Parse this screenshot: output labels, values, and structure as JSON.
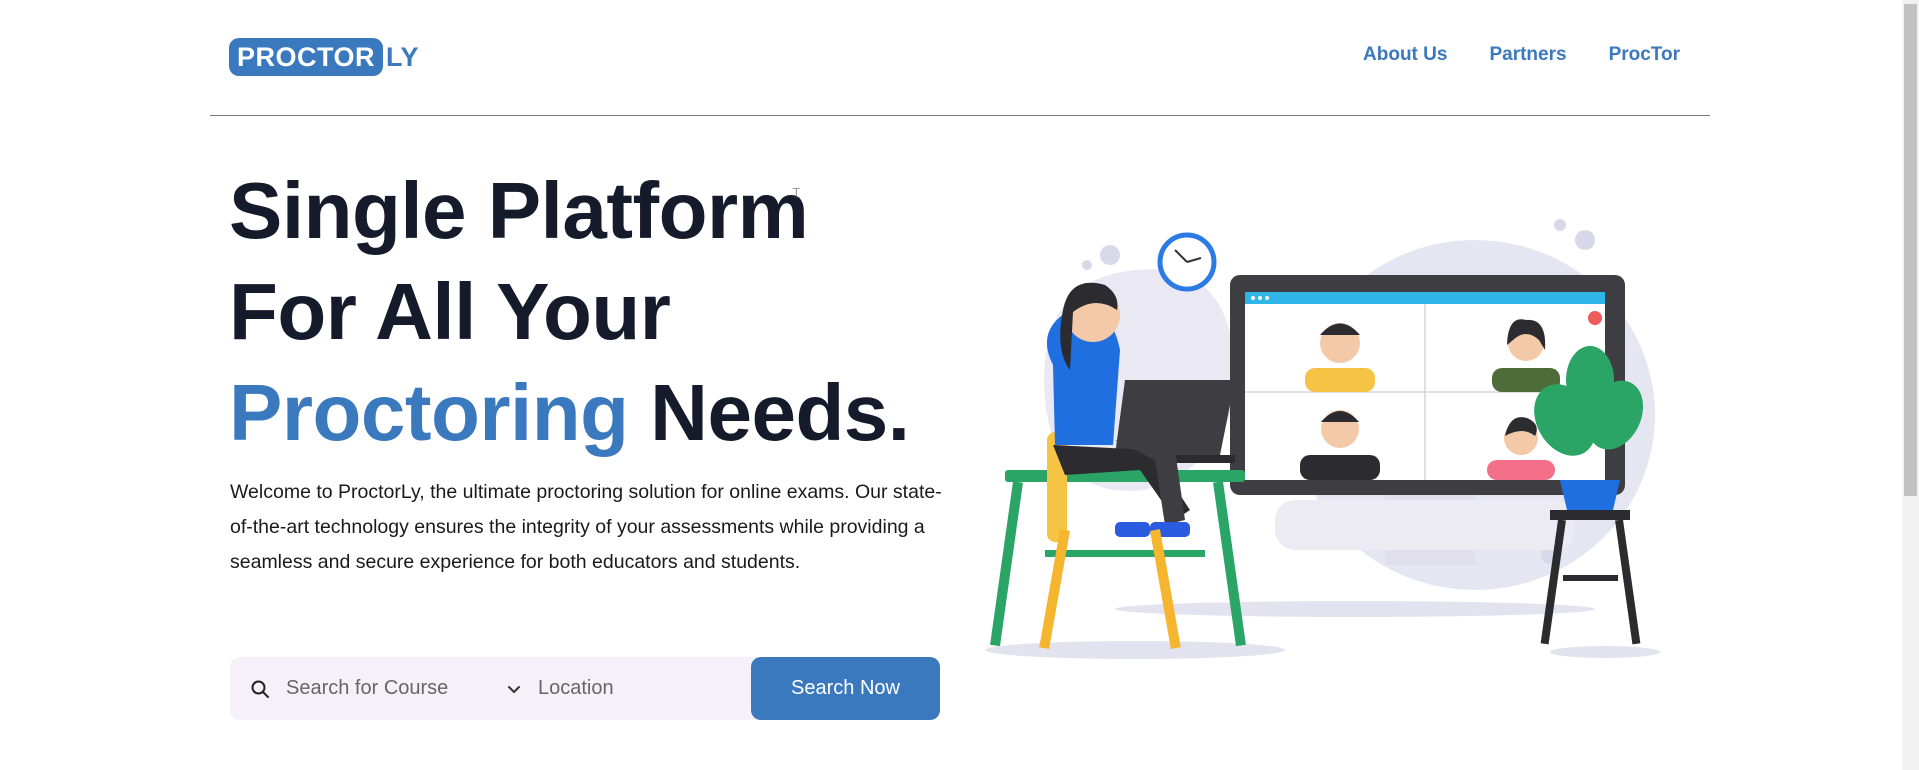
{
  "header": {
    "logo": {
      "boxed": "PROCTOR",
      "rest": "LY"
    },
    "nav": [
      "About Us",
      "Partners",
      "ProcTor"
    ]
  },
  "hero": {
    "title": {
      "line1": "Single Platform",
      "line2": "For All Your",
      "line3_accent": "Proctoring",
      "line3_rest": " Needs."
    },
    "description": "Welcome to ProctorLy, the ultimate proctoring solution for online exams. Our state-of-the-art technology ensures the integrity of your assessments while providing a seamless and secure experience for both educators and students."
  },
  "search": {
    "course_placeholder": "Search for Course",
    "location_placeholder": "Location",
    "button_label": "Search Now",
    "search_icon": "search-icon",
    "chevron_icon": "chevron-down-icon"
  },
  "colors": {
    "accent": "#3a79bd",
    "title": "#151b2b",
    "search_bg": "#f6f1f8"
  }
}
